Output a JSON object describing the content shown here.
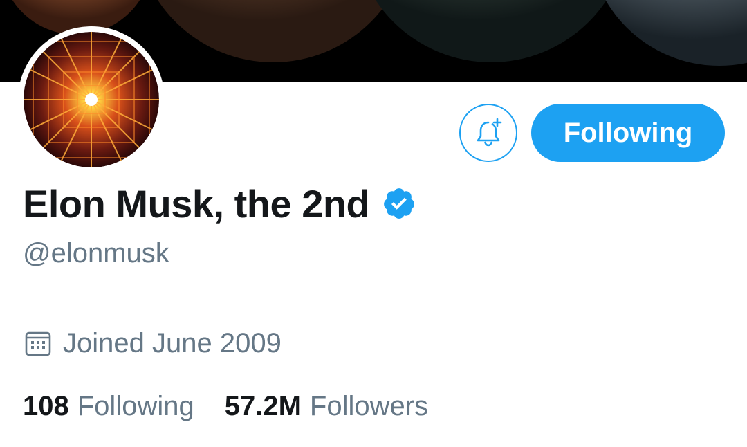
{
  "profile": {
    "name": "Elon Musk, the 2nd",
    "handle": "@elonmusk",
    "joined": "Joined June 2009",
    "following_button_label": "Following"
  },
  "stats": {
    "following_count": "108",
    "following_label": "Following",
    "followers_count": "57.2M",
    "followers_label": "Followers"
  },
  "icons": {
    "bell": "bell-plus-icon",
    "verified": "verified-badge-icon",
    "calendar": "calendar-icon"
  },
  "colors": {
    "accent": "#1da1f2",
    "text_primary": "#14171a",
    "text_secondary": "#657786"
  }
}
